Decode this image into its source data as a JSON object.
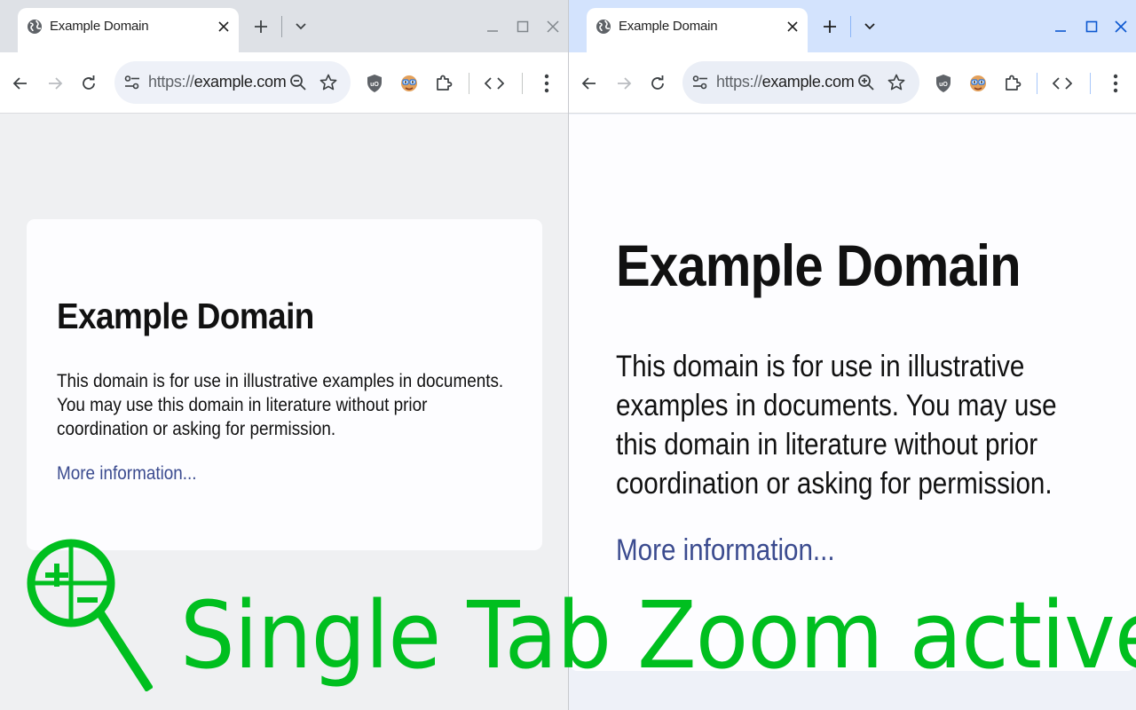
{
  "tab": {
    "title": "Example Domain",
    "close_glyph": "X"
  },
  "window_controls": {
    "minimize": "minimize-icon",
    "maximize": "maximize-icon",
    "close": "close-icon"
  },
  "omnibox": {
    "scheme": "https://",
    "host": "example.com"
  },
  "page": {
    "heading": "Example Domain",
    "paragraph": "This domain is for use in illustrative examples in documents. You may use this domain in literature without prior coordination or asking for permission.",
    "link": "More information..."
  },
  "overlay": {
    "text": "Single Tab Zoom active"
  },
  "colors": {
    "overlay_green": "#00bf1f",
    "link": "#3b4b8f",
    "active_frame": "#d3e3fd",
    "inactive_frame": "#dee1e6"
  }
}
